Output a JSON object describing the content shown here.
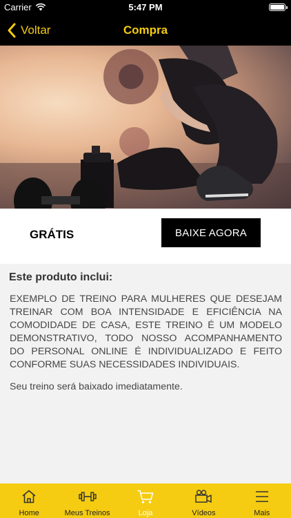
{
  "status_bar": {
    "carrier": "Carrier",
    "time": "5:47 PM"
  },
  "nav": {
    "back_label": "Voltar",
    "title": "Compra"
  },
  "hero": {
    "description_icon": "workout-photo"
  },
  "purchase": {
    "price": "GRÁTIS",
    "download_button": "BAIXE AGORA"
  },
  "product": {
    "heading": "Este produto inclui:",
    "description": "EXEMPLO DE TREINO PARA MULHERES QUE DESEJAM TREINAR COM BOA INTENSIDADE E EFICIÊNCIA NA COMODIDADE DE CASA, ESTE TREINO É UM MODELO DEMONSTRATIVO,  TODO NOSSO ACOMPANHAMENTO DO PERSONAL ONLINE  É INDIVIDUALIZADO E FEITO CONFORME SUAS NECESSIDADES INDIVIDUAIS.",
    "note": "Seu treino será baixado imediatamente."
  },
  "tabs": [
    {
      "label": "Home",
      "icon": "home-icon",
      "active": false
    },
    {
      "label": "Meus Treinos",
      "icon": "dumbbell-icon",
      "active": false
    },
    {
      "label": "Loja",
      "icon": "cart-icon",
      "active": true
    },
    {
      "label": "Vídeos",
      "icon": "video-camera-icon",
      "active": false
    },
    {
      "label": "Mais",
      "icon": "menu-icon",
      "active": false
    }
  ],
  "colors": {
    "accent": "#f5cc12",
    "bar": "#000000",
    "content_bg": "#f2f2f2"
  }
}
